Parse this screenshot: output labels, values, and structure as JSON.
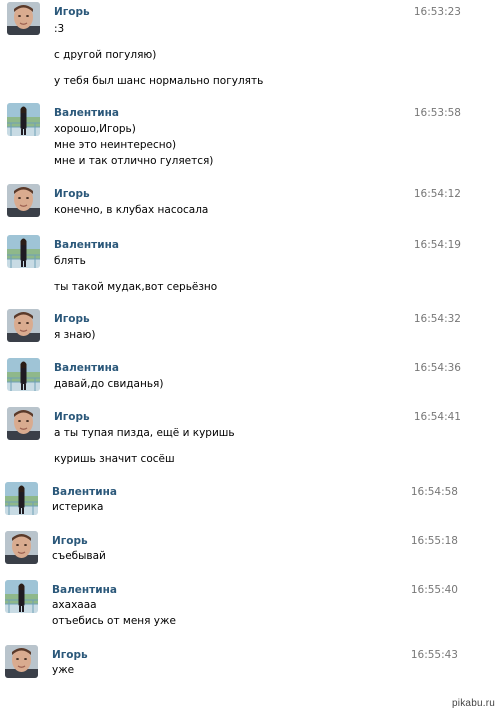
{
  "messages": [
    {
      "author": "Игорь",
      "avatar": "igor",
      "time": "16:53:23",
      "lines": [
        ":3",
        "с другой погуляю)",
        "у тебя был шанс нормально погулять"
      ]
    },
    {
      "author": "Валентина",
      "avatar": "valentina",
      "time": "16:53:58",
      "lines": [
        "хорошо,Игорь)",
        "мне это неинтересно)",
        "мне и так отлично гуляется)"
      ]
    },
    {
      "author": "Игорь",
      "avatar": "igor",
      "time": "16:54:12",
      "lines": [
        "конечно, в клубах насосала"
      ]
    },
    {
      "author": "Валентина",
      "avatar": "valentina",
      "time": "16:54:19",
      "lines": [
        "блять",
        "ты такой мудак,вот серьёзно"
      ]
    },
    {
      "author": "Игорь",
      "avatar": "igor",
      "time": "16:54:32",
      "lines": [
        "я знаю)"
      ]
    },
    {
      "author": "Валентина",
      "avatar": "valentina",
      "time": "16:54:36",
      "lines": [
        "давай,до свиданья)"
      ]
    },
    {
      "author": "Игорь",
      "avatar": "igor",
      "time": "16:54:41",
      "lines": [
        "а ты тупая пизда, ещё и куришь",
        "куришь значит сосёш"
      ]
    },
    {
      "author": "Валентина",
      "avatar": "valentina",
      "time": "16:54:58",
      "lines": [
        "истерика"
      ]
    },
    {
      "author": "Игорь",
      "avatar": "igor",
      "time": "16:55:18",
      "lines": [
        "съебывай"
      ]
    },
    {
      "author": "Валентина",
      "avatar": "valentina",
      "time": "16:55:40",
      "lines": [
        "ахахааа",
        "отъебись от меня уже"
      ]
    },
    {
      "author": "Игорь",
      "avatar": "igor",
      "time": "16:55:43",
      "lines": [
        "уже"
      ]
    }
  ],
  "watermark": "pikabu.ru",
  "colors": {
    "author": "#2b587a",
    "time": "#777777",
    "text": "#000000",
    "background": "#ffffff"
  }
}
